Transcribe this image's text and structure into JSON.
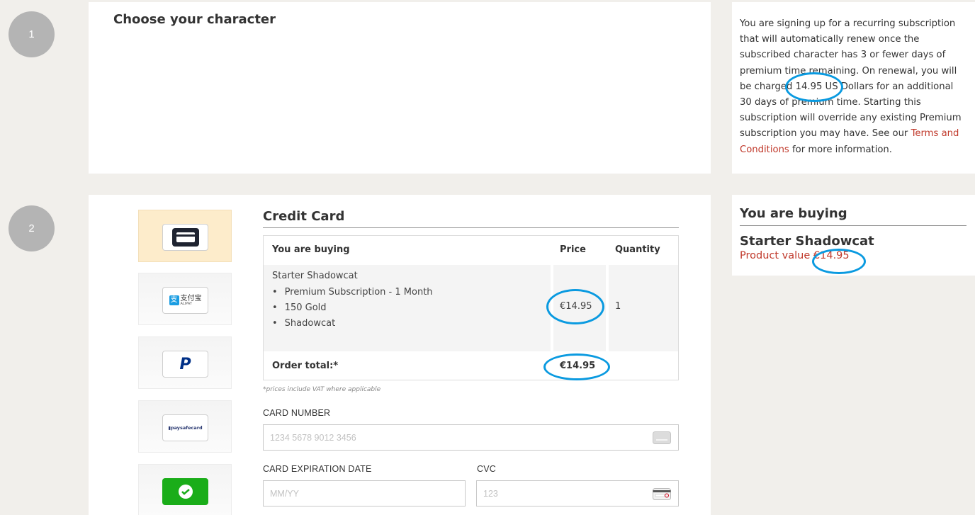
{
  "steps": {
    "one": "1",
    "two": "2"
  },
  "section1": {
    "title": "Choose your character"
  },
  "info": {
    "text_before": "You are signing up for a recurring subscription that will automatically renew once the subscribed character has 3 or fewer days of premium time remaining. On renewal, you will be charged 14.95 US Dollars for an additional 30 days of premium time. Starting this subscription will override any existing Premium subscription you may have. See our ",
    "link": "Terms and Conditions",
    "text_after": " for more information."
  },
  "payment_methods": [
    {
      "name": "credit-card",
      "active": true
    },
    {
      "name": "alipay",
      "label": "支付宝",
      "sublabel": "ALIPAY"
    },
    {
      "name": "paypal"
    },
    {
      "name": "paysafecard",
      "label": "paysafecard"
    },
    {
      "name": "wechat"
    }
  ],
  "credit_card": {
    "title": "Credit Card",
    "table": {
      "col_item": "You are buying",
      "col_price": "Price",
      "col_qty": "Quantity",
      "product": "Starter Shadowcat",
      "items": [
        "Premium Subscription - 1 Month",
        "150 Gold",
        "Shadowcat"
      ],
      "price": "€14.95",
      "qty": "1",
      "total_label": "Order total:*",
      "total": "€14.95"
    },
    "vat_note": "*prices include VAT where applicable",
    "card_number_label": "CARD NUMBER",
    "card_number_placeholder": "1234 5678 9012 3456",
    "expiry_label": "CARD EXPIRATION DATE",
    "expiry_placeholder": "MM/YY",
    "cvc_label": "CVC",
    "cvc_placeholder": "123"
  },
  "summary": {
    "title": "You are buying",
    "product": "Starter Shadowcat",
    "value_label": "Product value ",
    "value": "€14.95"
  },
  "colors": {
    "accent": "#c0392b",
    "highlight_circle": "#0a9ae0",
    "active_method": "#fdeccb"
  }
}
